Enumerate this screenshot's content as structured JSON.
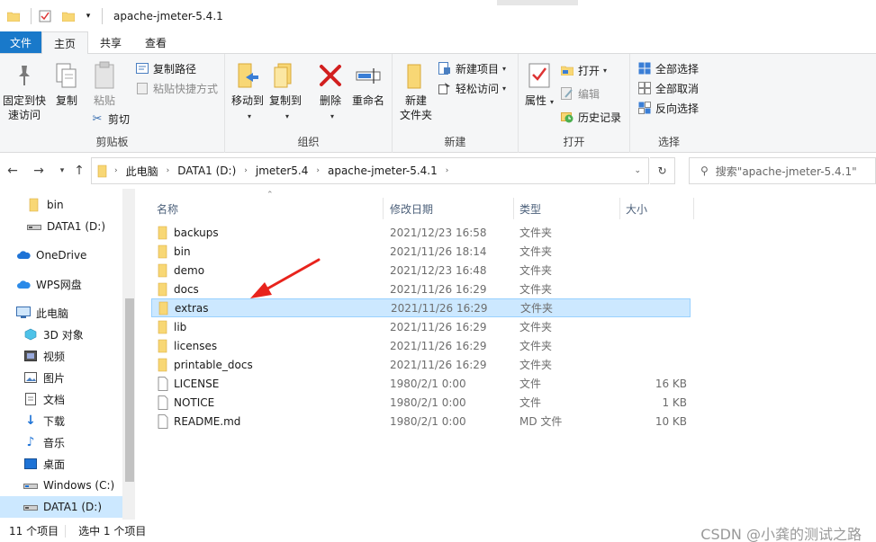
{
  "window": {
    "title": "apache-jmeter-5.4.1"
  },
  "tabs": [
    {
      "label": "文件"
    },
    {
      "label": "主页"
    },
    {
      "label": "共享"
    },
    {
      "label": "查看"
    }
  ],
  "ribbon": {
    "clipboard": {
      "label": "剪贴板",
      "pin": "固定到快\n速访问",
      "copy": "复制",
      "paste": "粘贴",
      "copy_path": "复制路径",
      "paste_shortcut": "粘贴快捷方式",
      "cut": "剪切"
    },
    "organize": {
      "label": "组织",
      "move_to": "移动到",
      "copy_to": "复制到",
      "delete": "删除",
      "rename": "重命名"
    },
    "new": {
      "label": "新建",
      "new_folder": "新建\n文件夹",
      "new_item": "新建项目",
      "easy_access": "轻松访问"
    },
    "open": {
      "label": "打开",
      "properties": "属性",
      "open": "打开",
      "edit": "编辑",
      "history": "历史记录"
    },
    "select": {
      "label": "选择",
      "select_all": "全部选择",
      "select_none": "全部取消",
      "invert": "反向选择"
    }
  },
  "address": {
    "crumbs": [
      "此电脑",
      "DATA1 (D:)",
      "jmeter5.4",
      "apache-jmeter-5.4.1"
    ],
    "search_placeholder": "搜索\"apache-jmeter-5.4.1\""
  },
  "nav": {
    "items": [
      {
        "label": "bin",
        "icon": "folder-icon"
      },
      {
        "label": "DATA1 (D:)",
        "icon": "drive-icon"
      },
      {
        "label": "OneDrive",
        "icon": "cloud-icon"
      },
      {
        "label": "WPS网盘",
        "icon": "cloud-icon"
      },
      {
        "label": "此电脑",
        "icon": "computer-icon"
      },
      {
        "label": "3D 对象",
        "icon": "cube-icon"
      },
      {
        "label": "视频",
        "icon": "video-icon"
      },
      {
        "label": "图片",
        "icon": "picture-icon"
      },
      {
        "label": "文档",
        "icon": "document-icon"
      },
      {
        "label": "下载",
        "icon": "download-icon"
      },
      {
        "label": "音乐",
        "icon": "music-icon"
      },
      {
        "label": "桌面",
        "icon": "desktop-icon"
      },
      {
        "label": "Windows (C:)",
        "icon": "drive-icon"
      },
      {
        "label": "DATA1 (D:)",
        "icon": "drive-icon"
      }
    ]
  },
  "columns": {
    "name": "名称",
    "date": "修改日期",
    "type": "类型",
    "size": "大小"
  },
  "files": [
    {
      "name": "backups",
      "date": "2021/12/23 16:58",
      "type": "文件夹",
      "size": "",
      "kind": "folder"
    },
    {
      "name": "bin",
      "date": "2021/11/26 18:14",
      "type": "文件夹",
      "size": "",
      "kind": "folder"
    },
    {
      "name": "demo",
      "date": "2021/12/23 16:48",
      "type": "文件夹",
      "size": "",
      "kind": "folder"
    },
    {
      "name": "docs",
      "date": "2021/11/26 16:29",
      "type": "文件夹",
      "size": "",
      "kind": "folder"
    },
    {
      "name": "extras",
      "date": "2021/11/26 16:29",
      "type": "文件夹",
      "size": "",
      "kind": "folder"
    },
    {
      "name": "lib",
      "date": "2021/11/26 16:29",
      "type": "文件夹",
      "size": "",
      "kind": "folder"
    },
    {
      "name": "licenses",
      "date": "2021/11/26 16:29",
      "type": "文件夹",
      "size": "",
      "kind": "folder"
    },
    {
      "name": "printable_docs",
      "date": "2021/11/26 16:29",
      "type": "文件夹",
      "size": "",
      "kind": "folder"
    },
    {
      "name": "LICENSE",
      "date": "1980/2/1 0:00",
      "type": "文件",
      "size": "16 KB",
      "kind": "file"
    },
    {
      "name": "NOTICE",
      "date": "1980/2/1 0:00",
      "type": "文件",
      "size": "1 KB",
      "kind": "file"
    },
    {
      "name": "README.md",
      "date": "1980/2/1 0:00",
      "type": "MD 文件",
      "size": "10 KB",
      "kind": "file"
    }
  ],
  "status": {
    "count": "11 个项目",
    "selected": "选中 1 个项目"
  },
  "watermark": "CSDN @小龚的测试之路",
  "colors": {
    "accent": "#1979ca",
    "selection": "#cce8ff",
    "folder": "#f8d775",
    "arrow": "#e8231c"
  }
}
